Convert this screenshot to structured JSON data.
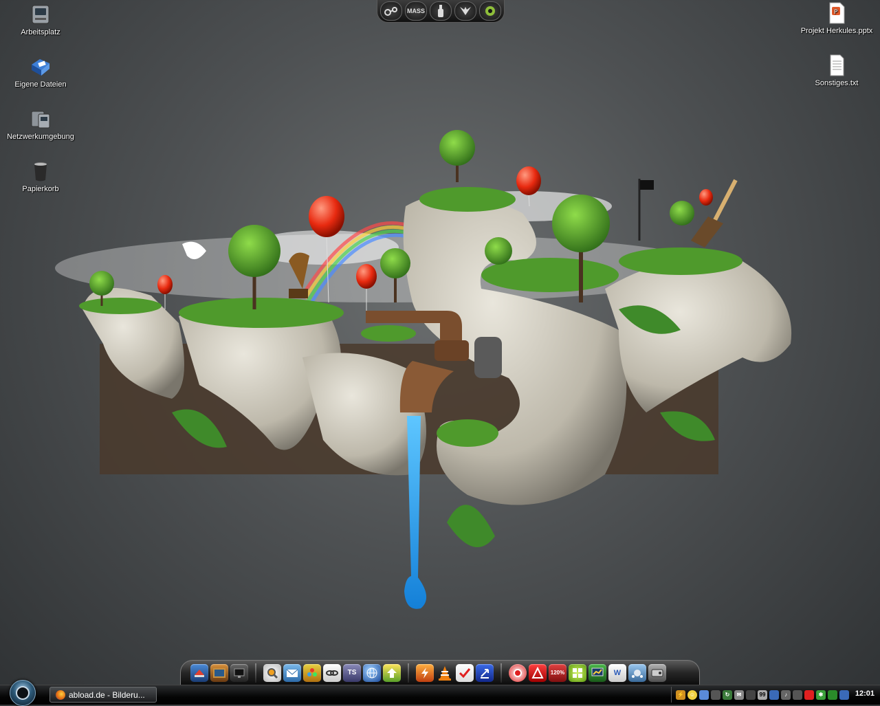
{
  "desktop_icons_left": [
    {
      "label": "Arbeitsplatz",
      "icon": "computer-icon"
    },
    {
      "label": "Eigene Dateien",
      "icon": "documents-folder-icon"
    },
    {
      "label": "Netzwerkumgebung",
      "icon": "network-icon"
    },
    {
      "label": "Papierkorb",
      "icon": "recycle-bin-icon"
    }
  ],
  "desktop_icons_right": [
    {
      "label": "Projekt Herkules.pptx",
      "icon": "powerpoint-file-icon"
    },
    {
      "label": "Sonstiges.txt",
      "icon": "text-file-icon"
    }
  ],
  "top_dock": {
    "items": [
      {
        "icon": "steam-icon",
        "label": ""
      },
      {
        "icon": "mass-effect-icon",
        "label": "MASS"
      },
      {
        "icon": "bottle-icon",
        "label": ""
      },
      {
        "icon": "wings-icon",
        "label": ""
      },
      {
        "icon": "spore-icon",
        "label": "SPORE"
      }
    ]
  },
  "bottom_dock": {
    "groups": [
      [
        "app-icon-1",
        "picture-frame-icon",
        "monitor-icon"
      ],
      [
        "magnifier-icon",
        "mail-icon",
        "flower-icon",
        "link-icon",
        "ts-icon",
        "globe-icon",
        "yellow-arrow-icon"
      ],
      [
        "lightning-icon",
        "vlc-cone-icon",
        "checklist-icon",
        "transfer-icon"
      ],
      [
        "red-circle-icon",
        "acrobat-icon",
        "display-icon",
        "mosaic-icon",
        "word-icon",
        "network-share-icon",
        "disk-icon"
      ]
    ],
    "labels": {
      "ts": "TS",
      "zoom": "120%",
      "word": "W"
    }
  },
  "taskbar": {
    "active_window": "abload.de - Bilderu...",
    "tray_text": "99",
    "clock": "12:01"
  },
  "colors": {
    "accent": "#1e90ff",
    "balloon": "#e82a10",
    "grass": "#4f9a2c"
  }
}
